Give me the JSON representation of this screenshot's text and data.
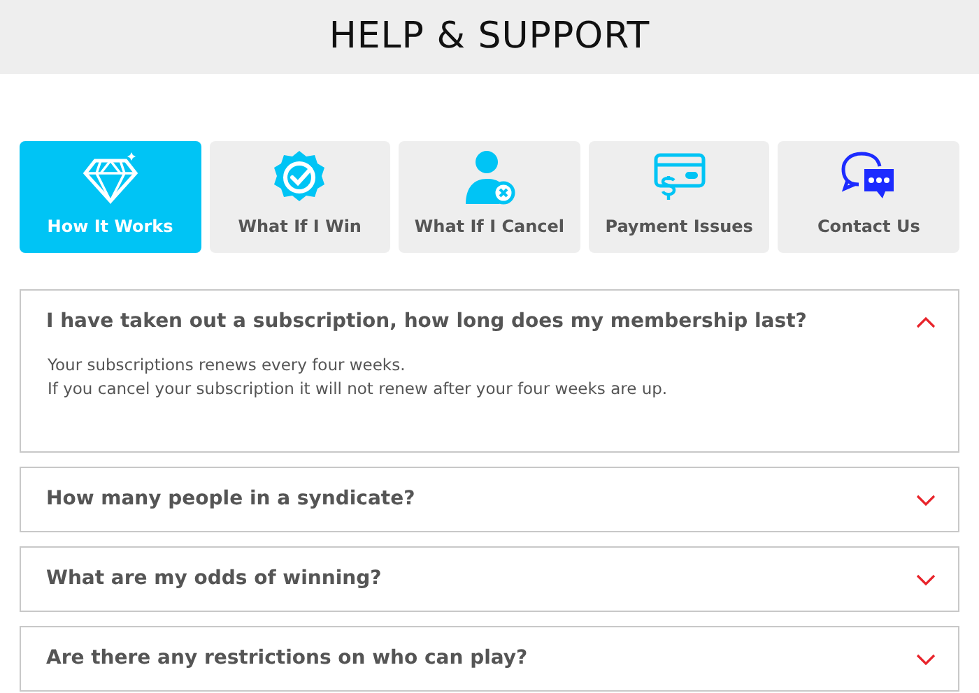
{
  "header": {
    "title": "HELP & SUPPORT"
  },
  "tabs": [
    {
      "label": "How It Works",
      "selected": true
    },
    {
      "label": "What If I Win",
      "selected": false
    },
    {
      "label": "What If I Cancel",
      "selected": false
    },
    {
      "label": "Payment Issues",
      "selected": false
    },
    {
      "label": "Contact Us",
      "selected": false
    }
  ],
  "faq": [
    {
      "question": "I have taken out a subscription, how long does my membership last?",
      "expanded": true,
      "answer": [
        "Your subscriptions renews every four weeks.",
        "If you cancel your subscription it will not renew after your four weeks are up."
      ]
    },
    {
      "question": "How many people in a syndicate?",
      "expanded": false
    },
    {
      "question": "What are my odds of winning?",
      "expanded": false
    },
    {
      "question": "Are there any restrictions on who can play?",
      "expanded": false
    }
  ]
}
